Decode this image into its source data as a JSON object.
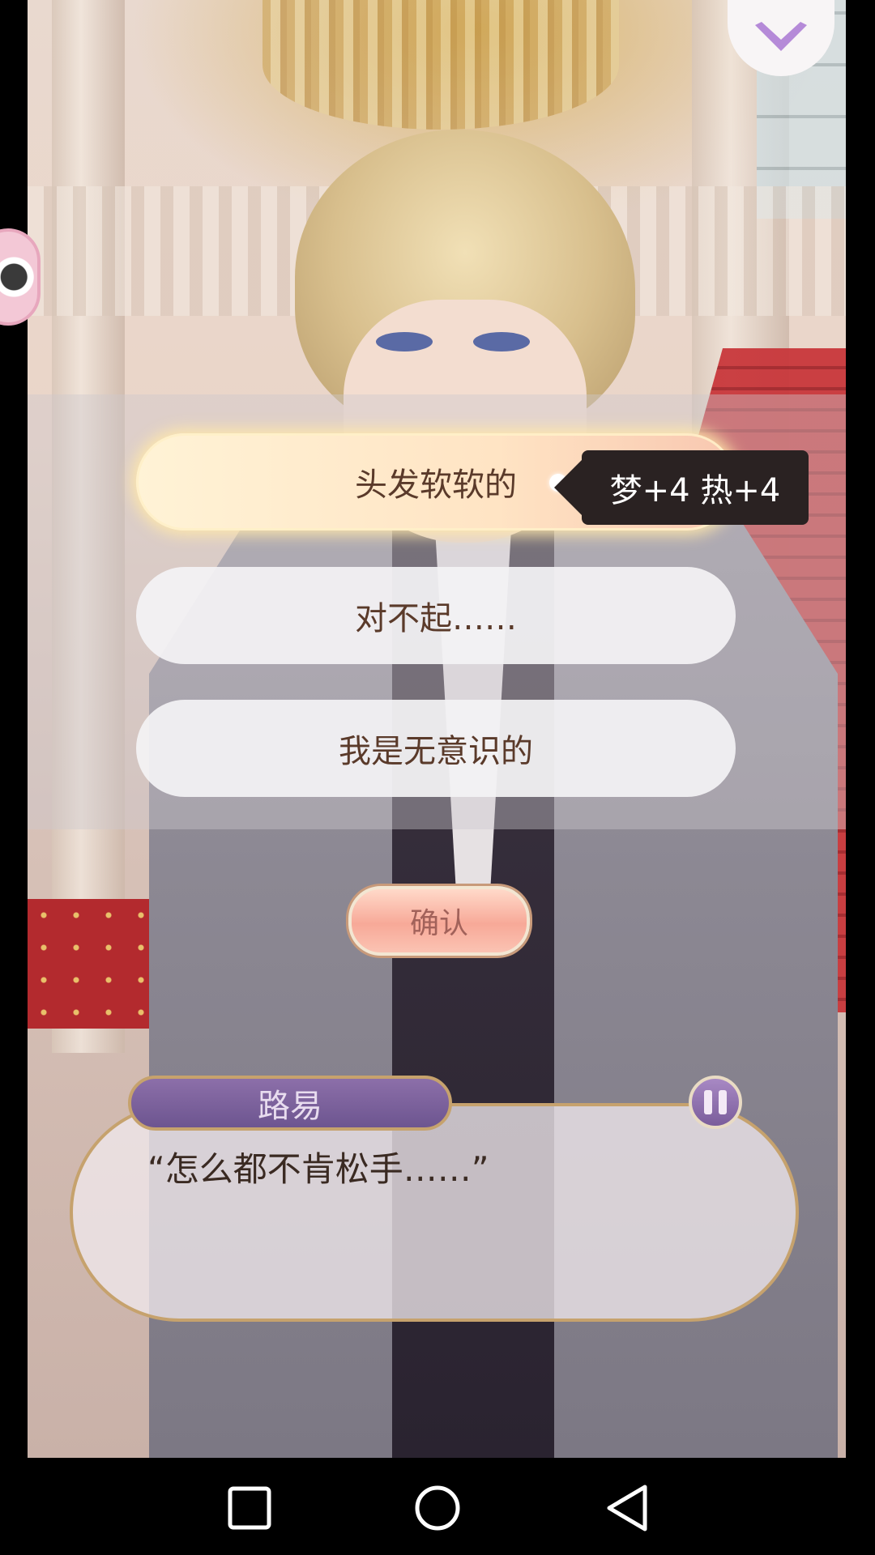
{
  "choices": [
    {
      "label": "头发软软的",
      "selected": true
    },
    {
      "label": "对不起……",
      "selected": false
    },
    {
      "label": "我是无意识的",
      "selected": false
    }
  ],
  "choice_tooltip": "梦+4 热+4",
  "confirm_label": "确认",
  "dialogue": {
    "speaker": "路易",
    "text": "“怎么都不肯松手……”"
  },
  "icons": {
    "collapse": "chevron-down-icon",
    "pause": "pause-icon",
    "assistive": "assistive-ball-icon",
    "nav_recent": "square-icon",
    "nav_home": "circle-icon",
    "nav_back": "triangle-back-icon"
  },
  "colors": {
    "accent_purple": "#b58ad8",
    "speaker_plate": "#7a5d9b",
    "confirm_pink": "#f7a998",
    "text_brown": "#5a3a2a"
  }
}
